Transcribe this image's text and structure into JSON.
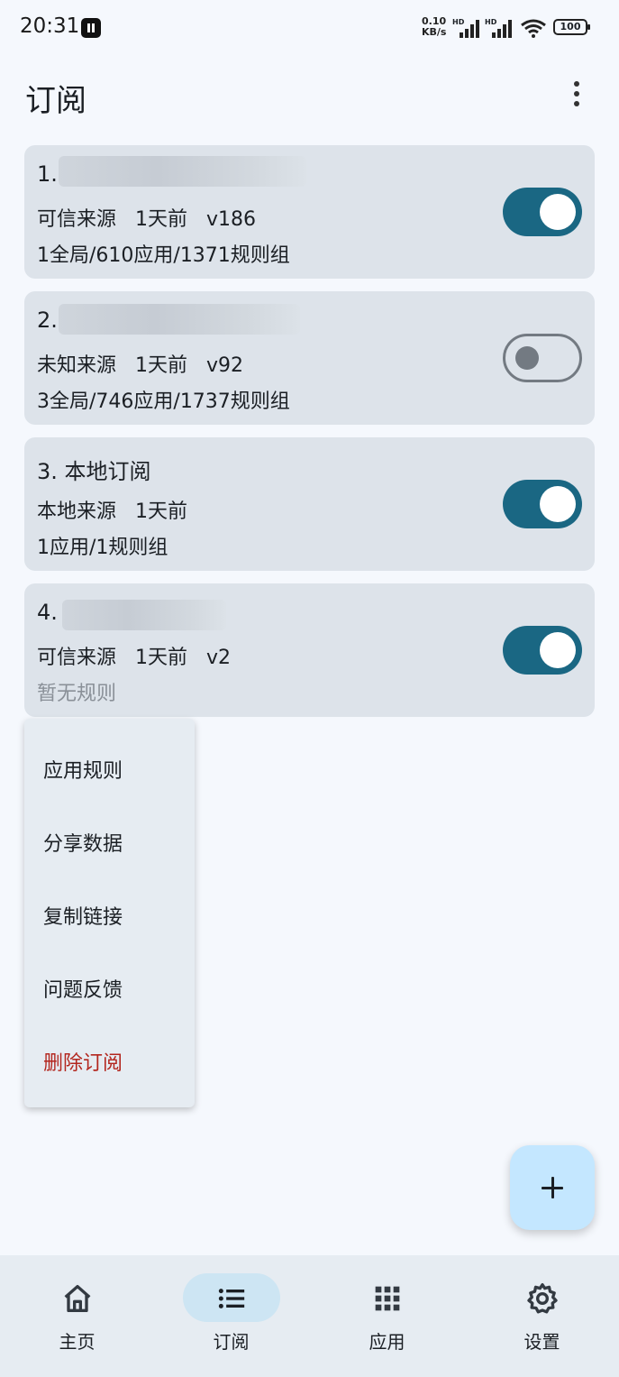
{
  "status_bar": {
    "time": "20:31",
    "net_speed_value": "0.10",
    "net_speed_unit": "KB/s",
    "signal_label": "HD",
    "battery": "100"
  },
  "header": {
    "title": "订阅"
  },
  "subscriptions": [
    {
      "index": "1.",
      "meta": "可信来源   1天前   v186",
      "counts": "1全局/610应用/1371规则组",
      "enabled": true
    },
    {
      "index": "2.",
      "meta": "未知来源   1天前   v92",
      "counts": "3全局/746应用/1737规则组",
      "enabled": false
    },
    {
      "index": "3. 本地订阅",
      "meta": "本地来源   1天前",
      "counts": "1应用/1规则组",
      "enabled": true
    },
    {
      "index": "4.",
      "meta": "可信来源   1天前   v2",
      "counts": "暂无规则",
      "enabled": true
    }
  ],
  "context_menu": {
    "items": [
      "应用规则",
      "分享数据",
      "复制链接",
      "问题反馈",
      "删除订阅"
    ]
  },
  "bottom_nav": {
    "items": [
      {
        "label": "主页",
        "icon": "home-icon"
      },
      {
        "label": "订阅",
        "icon": "list-icon"
      },
      {
        "label": "应用",
        "icon": "apps-grid-icon"
      },
      {
        "label": "设置",
        "icon": "gear-icon"
      }
    ],
    "active_index": 1
  },
  "colors": {
    "accent": "#1a6783",
    "card": "#dde3ea",
    "danger": "#b3261e",
    "fab": "#c4e7ff",
    "nav_active": "#cde5f3"
  }
}
